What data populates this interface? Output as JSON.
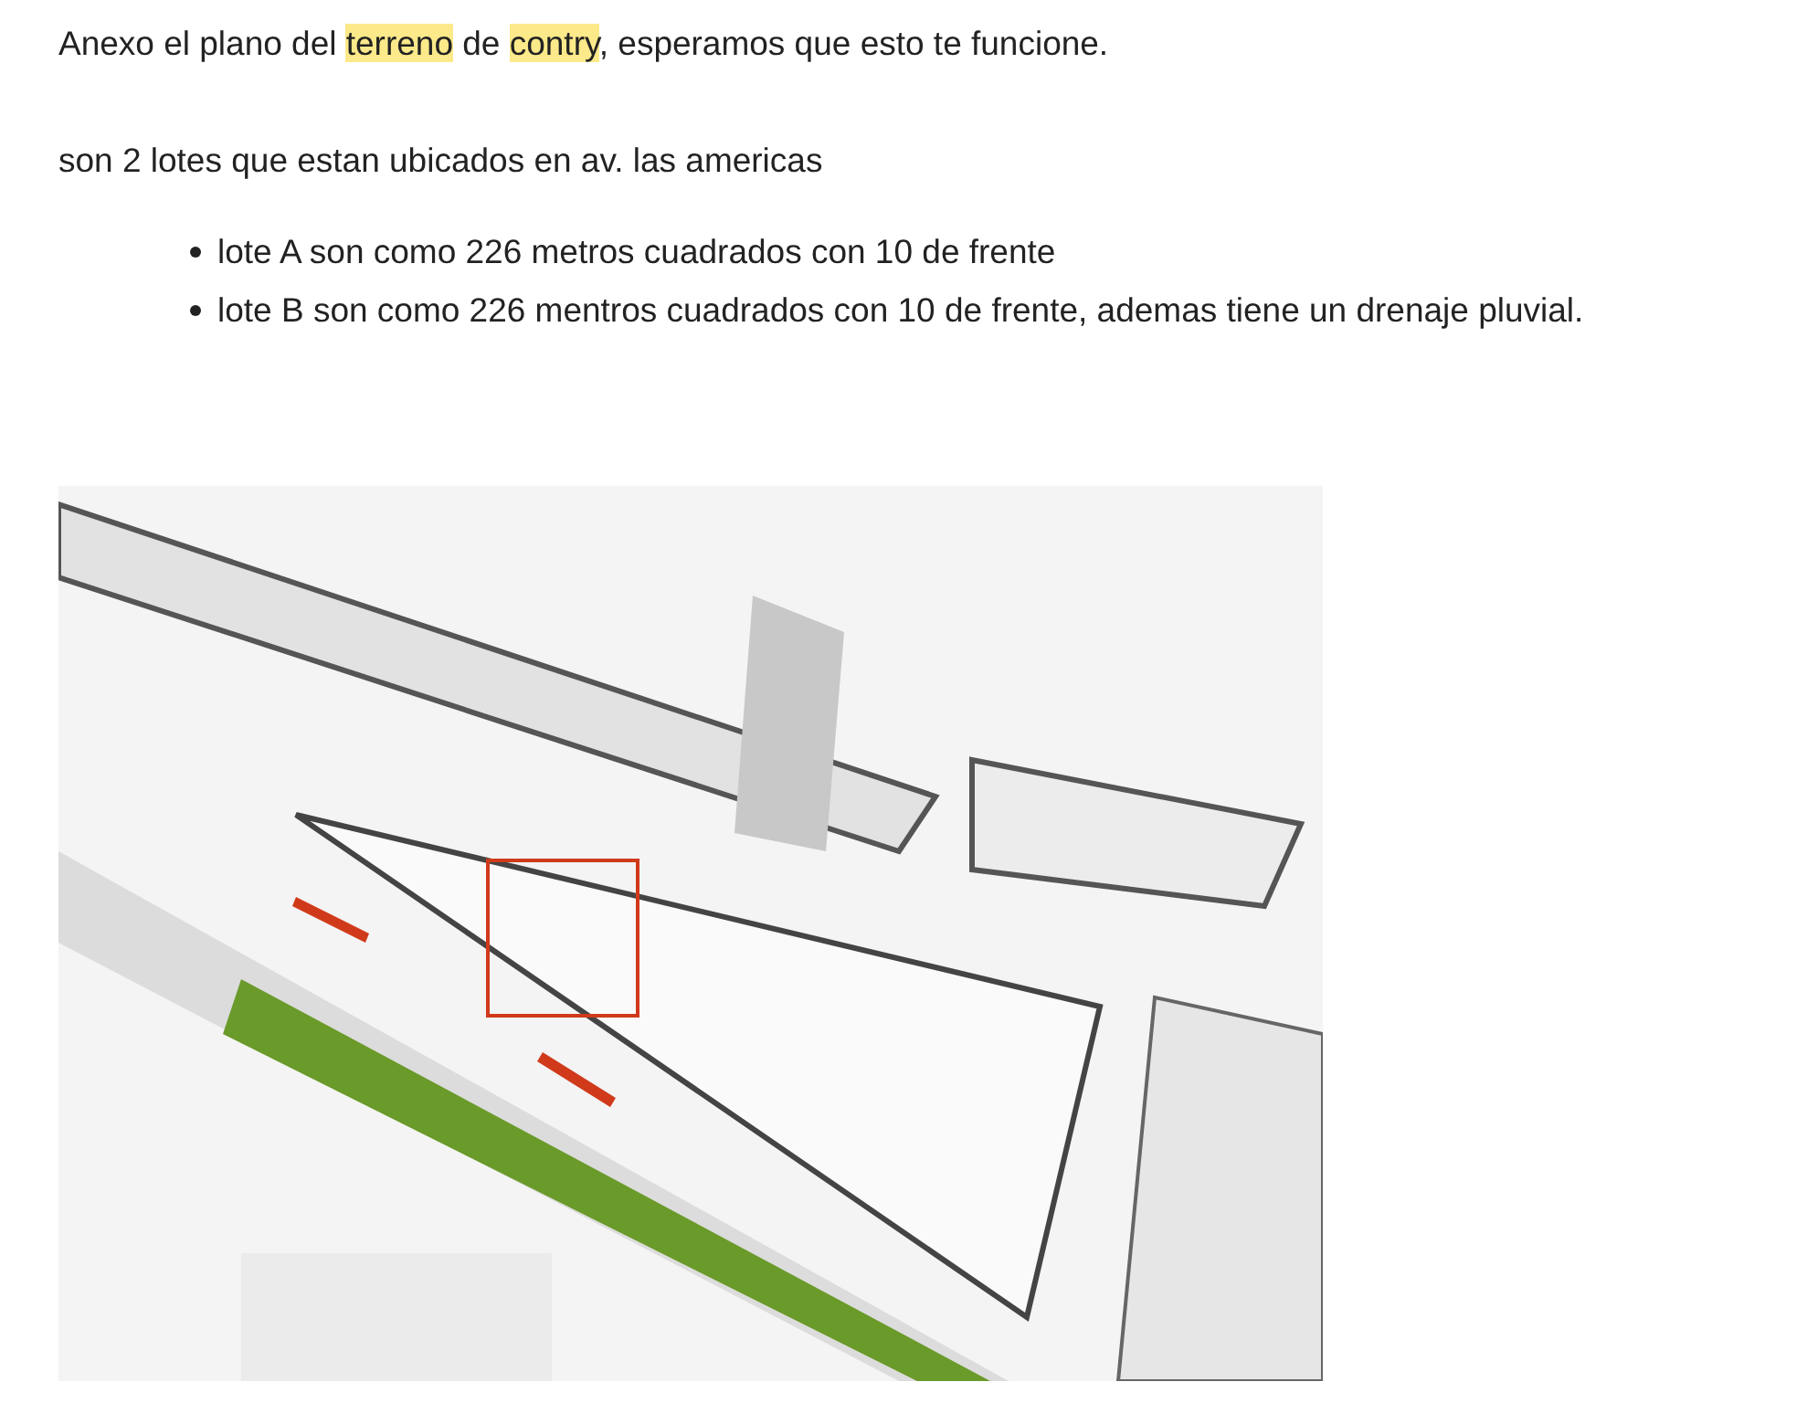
{
  "intro": [
    {
      "text": "Anexo el plano del ",
      "highlighted": false
    },
    {
      "text": "terreno",
      "highlighted": true
    },
    {
      "text": " de ",
      "highlighted": false
    },
    {
      "text": "contry",
      "highlighted": true
    },
    {
      "text": ", esperamos que esto te funcione.",
      "highlighted": false
    }
  ],
  "paragraph": "son 2 lotes que estan ubicados en av. las americas",
  "list": [
    "lote A son como 226 metros cuadrados con 10 de frente",
    "lote B son como 226 mentros cuadrados con 10 de frente, ademas tiene un drenaje pluvial."
  ]
}
